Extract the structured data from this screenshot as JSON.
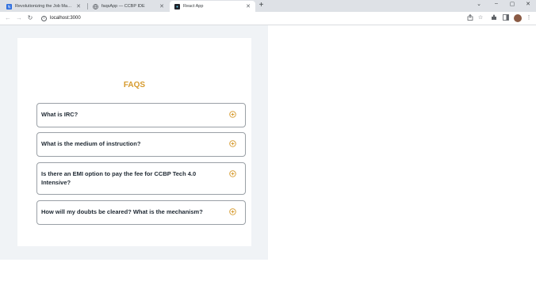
{
  "browser": {
    "tabs": [
      {
        "title": "Revolutionizing the Job Market |",
        "active": false
      },
      {
        "title": "faqsApp — CCBP IDE",
        "active": false
      },
      {
        "title": "React App",
        "active": true
      }
    ],
    "new_tab_label": "+",
    "url": "localhost:3000",
    "window_controls": {
      "tab_search": "⌄",
      "minimize": "–",
      "maximize": "▢",
      "close": "✕"
    }
  },
  "faqs": {
    "heading": "FAQS",
    "items": [
      {
        "question": "What is IRC?"
      },
      {
        "question": "What is the medium of instruction?"
      },
      {
        "question": "Is there an EMI option to pay the fee for CCBP Tech 4.0 Intensive?"
      },
      {
        "question": "How will my doubts be cleared? What is the mechanism?"
      }
    ]
  },
  "colors": {
    "accent": "#d69a2d",
    "app_background": "#f0f3f6",
    "card_background": "#ffffff",
    "item_border": "#9aa0a6",
    "question_text": "#1f2933"
  }
}
